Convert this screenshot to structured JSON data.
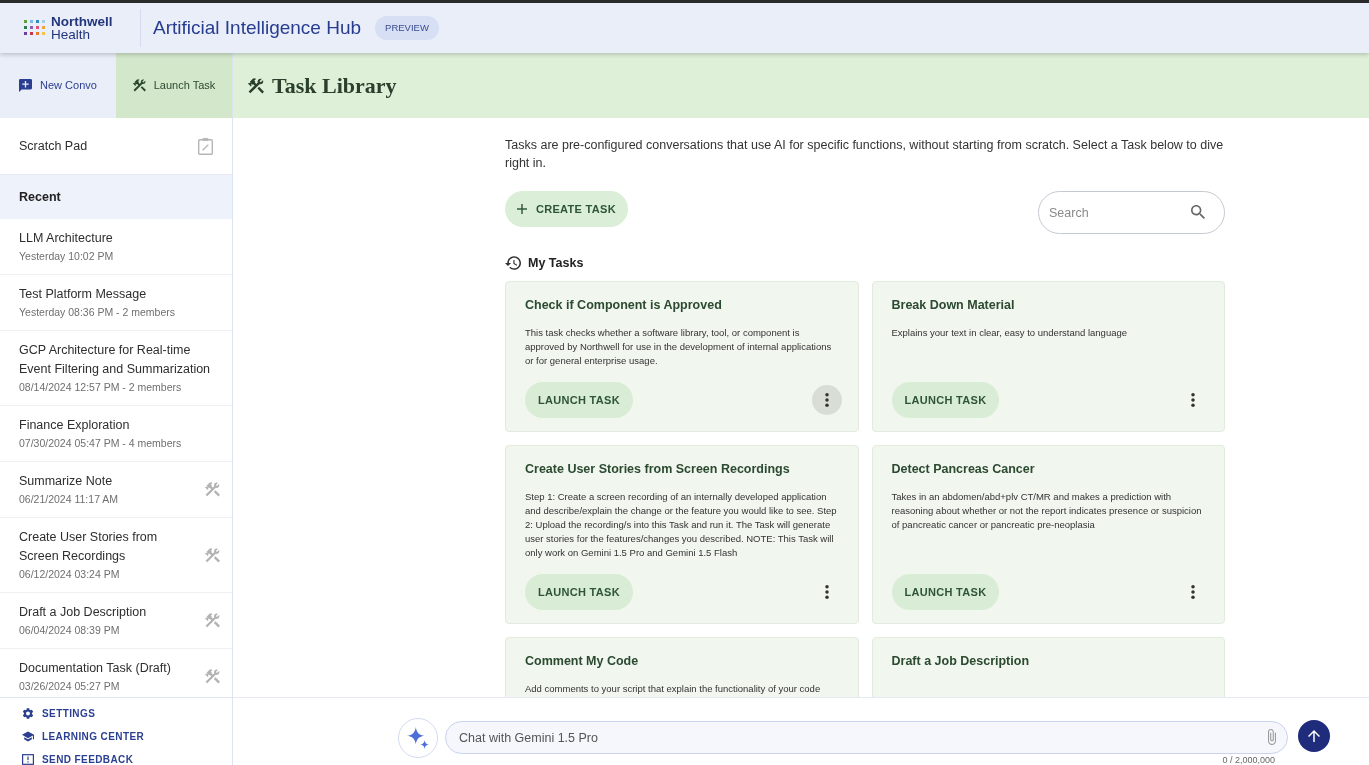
{
  "header": {
    "logo": {
      "line_1": "Northwell",
      "line_2": "Health"
    },
    "title": "Artificial Intelligence Hub",
    "badge": "PREVIEW"
  },
  "sidebar": {
    "tabs": [
      {
        "kind": "chat",
        "label": "New Convo",
        "selected": false
      },
      {
        "kind": "task",
        "label": "Launch Task",
        "selected": true
      }
    ],
    "scratch_pad": "Scratch Pad",
    "recent_heading": "Recent",
    "items": [
      {
        "kind": "convo",
        "title": "LLM Architecture",
        "meta": "Yesterday 10:02 PM"
      },
      {
        "kind": "convo",
        "title": "Test Platform Message",
        "meta": "Yesterday 08:36 PM - 2 members"
      },
      {
        "kind": "convo",
        "title": "GCP Architecture for Real-time Event Filtering and Summarization",
        "meta": "08/14/2024 12:57 PM - 2 members"
      },
      {
        "kind": "convo",
        "title": "Finance Exploration",
        "meta": "07/30/2024 05:47 PM - 4 members"
      },
      {
        "kind": "task",
        "title": "Summarize Note",
        "meta": "06/21/2024 11:17 AM"
      },
      {
        "kind": "task",
        "title": "Create User Stories from Screen Recordings",
        "meta": "06/12/2024 03:24 PM"
      },
      {
        "kind": "task",
        "title": "Draft a Job Description",
        "meta": "06/04/2024 08:39 PM"
      },
      {
        "kind": "task",
        "title": "Documentation Task (Draft)",
        "meta": "03/26/2024 05:27 PM"
      }
    ],
    "links": [
      {
        "kind": "settings",
        "label": "SETTINGS"
      },
      {
        "kind": "learning",
        "label": "LEARNING CENTER"
      },
      {
        "kind": "feedback",
        "label": "SEND FEEDBACK"
      }
    ]
  },
  "main": {
    "heading": "Task Library",
    "intro": "Tasks are pre-configured conversations that use AI for specific functions, without starting from scratch. Select a Task below to dive right in.",
    "create_button": "CREATE TASK",
    "search": {
      "placeholder": "Search"
    },
    "section_heading": "My Tasks",
    "cards": [
      {
        "title": "Check if Component is Approved",
        "description": "This task checks whether a software library, tool, or component is approved by Northwell for use in the development of internal applications or for general enterprise usage.",
        "button": "LAUNCH TASK",
        "menu_hovered": true
      },
      {
        "title": "Break Down Material",
        "description": "Explains your text in clear, easy to understand language",
        "button": "LAUNCH TASK",
        "menu_hovered": false
      },
      {
        "title": "Create User Stories from Screen Recordings",
        "description": "Step 1: Create a screen recording of an internally developed application and describe/explain the change or the feature you would like to see. Step 2: Upload the recording/s into this Task and run it. The Task will generate user stories for the features/changes you described. NOTE: This Task will only work on Gemini 1.5 Pro and Gemini 1.5 Flash",
        "button": "LAUNCH TASK",
        "menu_hovered": false
      },
      {
        "title": "Detect Pancreas Cancer",
        "description": "Takes in an abdomen/abd+plv CT/MR and makes a prediction with reasoning about whether or not the report indicates presence or suspicion of pancreatic cancer or pancreatic pre-neoplasia",
        "button": "LAUNCH TASK",
        "menu_hovered": false
      },
      {
        "title": "Comment My Code",
        "description": "Add comments to your script that explain the functionality of your code"
      },
      {
        "title": "Draft a Job Description"
      }
    ]
  },
  "chat": {
    "placeholder": "Chat with Gemini 1.5 Pro",
    "counter": "0 / 2,000,000"
  }
}
